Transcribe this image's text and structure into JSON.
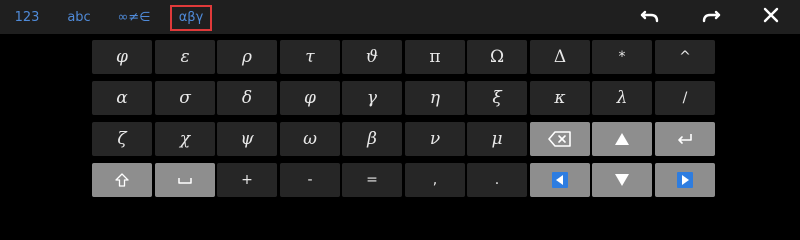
{
  "tabs": [
    {
      "label": "123",
      "active": false
    },
    {
      "label": "abc",
      "active": false
    },
    {
      "label": "∞≠∈",
      "active": false
    },
    {
      "label": "αβγ",
      "active": true
    }
  ],
  "toolbar": {
    "undo_icon": "undo-icon",
    "redo_icon": "redo-icon",
    "close_icon": "close-icon"
  },
  "colors": {
    "tab_text": "#4f8ad8",
    "active_tab_border": "#e03a3a",
    "key_bg": "#262626",
    "special_key_bg": "#8e8e8e",
    "arrow_blue": "#2e7de0"
  },
  "keys": {
    "row1": [
      "φ",
      "ε",
      "ρ",
      "τ",
      "ϑ",
      "π",
      "Ω",
      "Δ",
      "*",
      "^"
    ],
    "row2": [
      "α",
      "σ",
      "δ",
      "φ",
      "γ",
      "η",
      "ξ",
      "κ",
      "λ",
      "/"
    ],
    "row3": [
      "ζ",
      "χ",
      "ψ",
      "ω",
      "β",
      "ν",
      "μ"
    ],
    "row3_icons": [
      "backspace-icon",
      "up-arrow-icon",
      "enter-icon"
    ],
    "row4_icons_left": [
      "shift-icon",
      "space-icon"
    ],
    "row4": [
      "+",
      "-",
      "=",
      ",",
      "."
    ],
    "row4_icons_right": [
      "left-arrow-icon",
      "down-arrow-icon",
      "right-arrow-icon"
    ]
  }
}
